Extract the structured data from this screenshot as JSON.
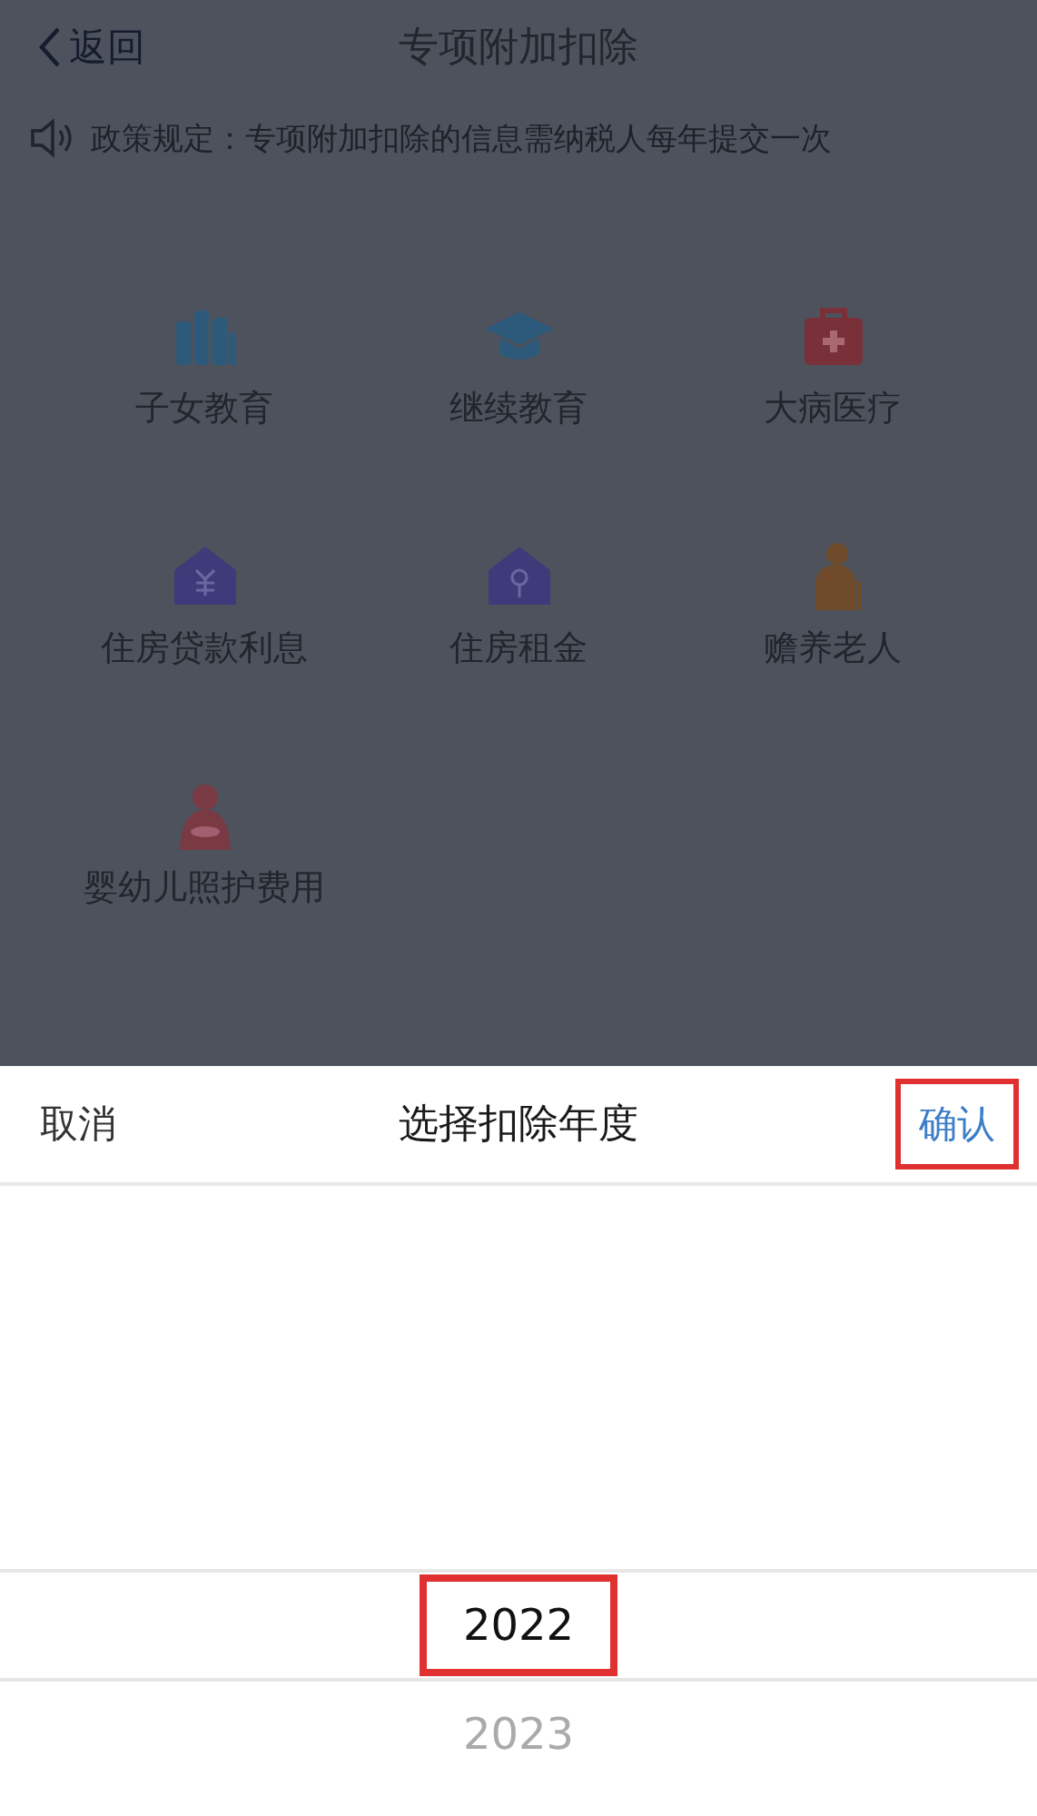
{
  "nav": {
    "back": "返回",
    "title": "专项附加扣除"
  },
  "notice": "政策规定：专项附加扣除的信息需纳税人每年提交一次",
  "categories": [
    {
      "kind": "books",
      "label": "子女教育"
    },
    {
      "kind": "cap",
      "label": "继续教育"
    },
    {
      "kind": "medkit",
      "label": "大病医疗"
    },
    {
      "kind": "house-yen",
      "label": "住房贷款利息"
    },
    {
      "kind": "house-pin",
      "label": "住房租金"
    },
    {
      "kind": "elder",
      "label": "赡养老人"
    },
    {
      "kind": "mother",
      "label": "婴幼儿照护费用"
    }
  ],
  "picker": {
    "cancel": "取消",
    "title": "选择扣除年度",
    "confirm": {
      "label": "确认",
      "highlighted": true
    },
    "options": [
      {
        "label": "2022",
        "selected": true,
        "highlighted": true
      },
      {
        "label": "2023",
        "selected": false,
        "highlighted": false
      }
    ]
  }
}
